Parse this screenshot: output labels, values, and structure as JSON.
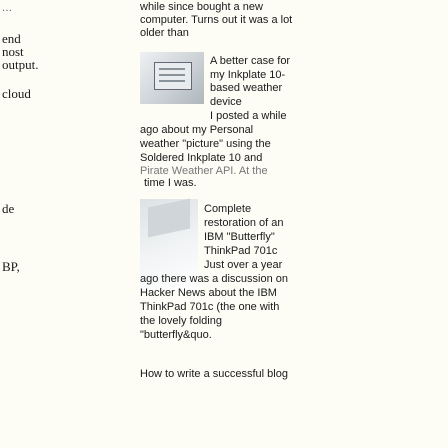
{
  "left": {
    "lines": [
      {
        "id": "l0",
        "text": "end",
        "link": false
      },
      {
        "id": "l1",
        "text": "nost",
        "link": false
      },
      {
        "id": "l2",
        "text": "output.",
        "link": false
      },
      {
        "id": "l3",
        "text": "cloud",
        "link": false
      },
      {
        "id": "l4",
        "text": "de",
        "link": false
      },
      {
        "id": "l5",
        "text": "BP,",
        "link": false
      }
    ]
  },
  "posts": {
    "p1": {
      "lines": [
        "while since bought a new",
        "computer. Turns out it was a lot",
        "older than"
      ]
    },
    "p2": {
      "lines": [
        "A better case for",
        "my Inkplate 10-",
        "based weather",
        "device",
        "I posted a while",
        "ago about my Personal",
        "weather \"picture\" using the",
        "Soldered Inkplate 10 and",
        "Pirate Weather API. At the",
        "time I was."
      ]
    },
    "p3": {
      "lines": [
        "Complete",
        "restoration of an",
        "IBM \"Butterfly\"",
        "ThinkPad 701c",
        "Just over a year",
        "ago there was a discussion on",
        "Hacker News about the IBM",
        "ThinkPad 701c (the one with",
        "the lovely folding",
        "\"butterfly&quo."
      ]
    },
    "p4": {
      "lines": [
        "How to write a successful blog"
      ]
    }
  }
}
